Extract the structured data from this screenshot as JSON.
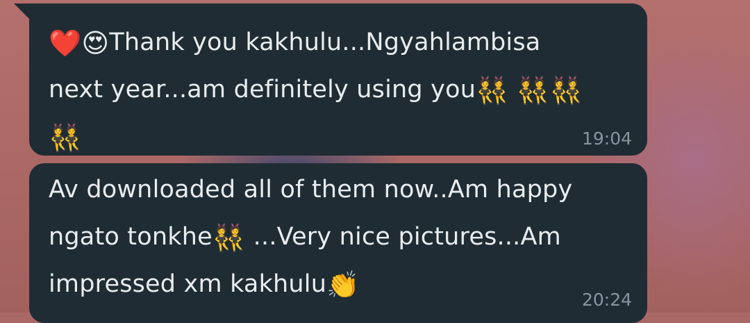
{
  "messages": [
    {
      "lines": [
        {
          "emoji_prefix": [
            "❤️",
            "😍"
          ],
          "text": "Thank you kakhulu...Ngyahlambisa"
        },
        {
          "text": "next year...am definitely using you",
          "emoji_suffix": [
            "👯",
            "👯",
            "👯",
            "👯"
          ]
        }
      ],
      "time": "19:04"
    },
    {
      "lines": [
        {
          "text": "Av downloaded all of them now..Am happy"
        },
        {
          "text": "ngato tonkhe",
          "emoji_mid": "👯",
          "text_after": " ...Very nice pictures...Am"
        },
        {
          "text": "impressed xm kakhulu",
          "emoji_suffix": [
            "👏"
          ]
        }
      ],
      "time": "20:24"
    }
  ]
}
